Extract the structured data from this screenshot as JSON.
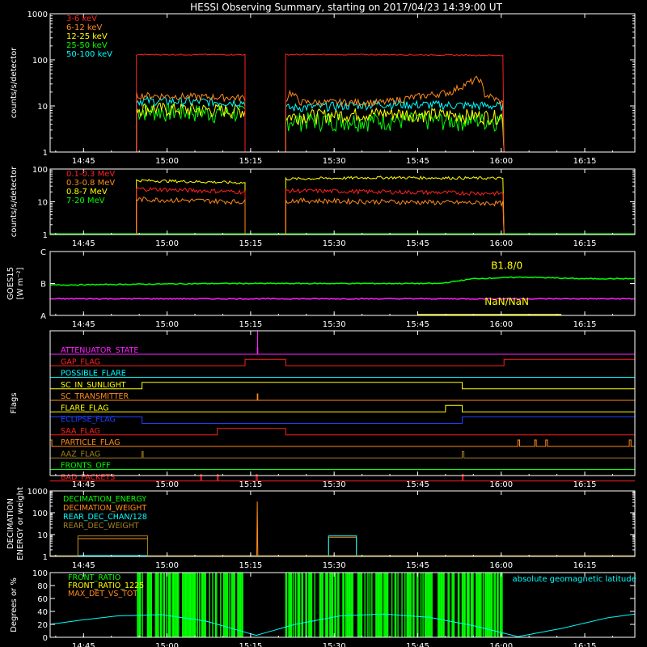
{
  "title": "HESSI Observing Summary, starting on 2017/04/23 14:39:00 UT",
  "x_ticks": [
    "14:45",
    "15:00",
    "15:15",
    "15:30",
    "15:45",
    "16:00",
    "16:15"
  ],
  "x_tick_minutes": [
    6,
    21,
    36,
    51,
    66,
    81,
    96
  ],
  "x_range_minutes": [
    0,
    105
  ],
  "colors": {
    "red": "#ff2020",
    "orange": "#ff8a1c",
    "yellow": "#ffff00",
    "green": "#00ff00",
    "cyan": "#00ffff",
    "magenta": "#ff20ff",
    "blue": "#2040ff",
    "olive": "#a08020",
    "white": "#ffffff"
  },
  "chart_data": [
    {
      "type": "line",
      "panel": "xray",
      "ylabel": "counts/s/detector",
      "yscale": "log",
      "ylim": [
        1,
        1000
      ],
      "y_ticks": [
        "1",
        "10",
        "100",
        "1000"
      ],
      "segments_minutes": [
        [
          15.5,
          35
        ],
        [
          42.3,
          81.5
        ]
      ],
      "series": [
        {
          "name": "3-6 keV",
          "color": "red",
          "values": [
            [
              15.5,
              130
            ],
            [
              35,
              130
            ],
            [
              42.3,
              130
            ],
            [
              60,
              130
            ],
            [
              81.5,
              125
            ]
          ]
        },
        {
          "name": "6-12 keV",
          "color": "orange",
          "values": [
            [
              15.5,
              17
            ],
            [
              35,
              15
            ],
            [
              42.3,
              12
            ],
            [
              43,
              20
            ],
            [
              45,
              12
            ],
            [
              60,
              12
            ],
            [
              72,
              20
            ],
            [
              76,
              35
            ],
            [
              77,
              40
            ],
            [
              78,
              18
            ],
            [
              81.5,
              11
            ]
          ]
        },
        {
          "name": "12-25 keV",
          "color": "yellow",
          "values": [
            [
              15.5,
              9
            ],
            [
              35,
              8
            ],
            [
              42.3,
              6
            ],
            [
              60,
              7
            ],
            [
              81.5,
              6
            ]
          ]
        },
        {
          "name": "25-50 keV",
          "color": "green",
          "values": [
            [
              15.5,
              8
            ],
            [
              35,
              7
            ],
            [
              42.3,
              5
            ],
            [
              60,
              5
            ],
            [
              81.5,
              5
            ]
          ]
        },
        {
          "name": "50-100 keV",
          "color": "cyan",
          "values": [
            [
              15.5,
              13
            ],
            [
              35,
              12
            ],
            [
              42.3,
              9
            ],
            [
              60,
              11
            ],
            [
              81.5,
              10
            ]
          ]
        }
      ]
    },
    {
      "type": "line",
      "panel": "gamma",
      "ylabel": "counts/s/detector",
      "yscale": "log",
      "ylim": [
        1,
        100
      ],
      "y_ticks": [
        "1",
        "10",
        "100"
      ],
      "segments_minutes": [
        [
          15.5,
          35
        ],
        [
          42.3,
          81.5
        ]
      ],
      "series": [
        {
          "name": "0.1-0.3 MeV",
          "color": "red",
          "values": [
            [
              15.5,
              25
            ],
            [
              35,
              20
            ],
            [
              42.3,
              22
            ],
            [
              81.5,
              18
            ]
          ]
        },
        {
          "name": "0.3-0.8 MeV",
          "color": "orange",
          "values": [
            [
              15.5,
              12
            ],
            [
              35,
              10
            ],
            [
              42.3,
              11
            ],
            [
              81.5,
              9
            ]
          ]
        },
        {
          "name": "0.8-7 MeV",
          "color": "yellow",
          "values": [
            [
              15.5,
              45
            ],
            [
              35,
              38
            ],
            [
              42.3,
              50
            ],
            [
              60,
              55
            ],
            [
              81.5,
              52
            ]
          ]
        },
        {
          "name": "7-20 MeV",
          "color": "green",
          "values": [
            [
              0,
              1
            ],
            [
              105,
              1
            ]
          ]
        }
      ]
    },
    {
      "type": "line",
      "panel": "goes",
      "ylabel": "GOES15",
      "ylabel2": "[W m⁻²]",
      "y_ticks": [
        "A",
        "B",
        "C"
      ],
      "ylim": [
        0,
        2
      ],
      "annotations": [
        "B1.8/0",
        "NaN/NaN"
      ],
      "series": [
        {
          "name": "",
          "color": "green",
          "values": [
            [
              0,
              0.95
            ],
            [
              30,
              1.0
            ],
            [
              70,
              1.0
            ],
            [
              76,
              1.15
            ],
            [
              85,
              1.2
            ],
            [
              95,
              1.15
            ],
            [
              105,
              1.15
            ]
          ]
        },
        {
          "name": "",
          "color": "magenta",
          "values": [
            [
              0,
              0.52
            ],
            [
              105,
              0.52
            ]
          ]
        },
        {
          "name": "",
          "color": "yellow",
          "values": [
            [
              66,
              0.0
            ],
            [
              92,
              0.0
            ]
          ]
        }
      ]
    },
    {
      "type": "line",
      "panel": "flags",
      "ylabel": "Flags",
      "flags": [
        {
          "label": "ATTENUATOR_STATE",
          "color": "magenta"
        },
        {
          "label": "GAP_FLAG",
          "color": "red"
        },
        {
          "label": "POSSIBLE_FLARE",
          "color": "cyan"
        },
        {
          "label": "SC_IN_SUNLIGHT",
          "color": "yellow"
        },
        {
          "label": "SC_TRANSMITTER",
          "color": "orange"
        },
        {
          "label": "FLARE_FLAG",
          "color": "yellow"
        },
        {
          "label": "ECLIPSE_FLAG",
          "color": "blue"
        },
        {
          "label": "SAA_FLAG",
          "color": "red"
        },
        {
          "label": "PARTICLE_FLAG",
          "color": "orange"
        },
        {
          "label": "AAZ_FLAG",
          "color": "olive"
        },
        {
          "label": "FRONTS_OFF",
          "color": "green"
        },
        {
          "label": "BAD_PACKETS",
          "color": "red"
        }
      ],
      "flag_high_minutes": [
        [
          [
            37.2,
            37.3
          ]
        ],
        [
          [
            35,
            42.3
          ],
          [
            81.5,
            105
          ]
        ],
        [],
        [
          [
            16.5,
            74
          ]
        ],
        [
          [
            37.2,
            37.3
          ]
        ],
        [
          [
            71,
            74
          ]
        ],
        [
          [
            0,
            16.5
          ],
          [
            74,
            105
          ]
        ],
        [
          [
            30,
            42.3
          ]
        ],
        [
          [
            0,
            0.3
          ],
          [
            84,
            84.3
          ],
          [
            87,
            87.3
          ],
          [
            89,
            89.3
          ],
          [
            104,
            104.3
          ]
        ],
        [
          [
            16.5,
            16.7
          ],
          [
            74,
            74.3
          ]
        ],
        [],
        [
          [
            27,
            27.2
          ],
          [
            30,
            30.2
          ],
          [
            37,
            37.2
          ],
          [
            74,
            74.2
          ]
        ]
      ]
    },
    {
      "type": "line",
      "panel": "decimation",
      "ylabel": "DECIMATION",
      "ylabel2": "ENERGY or weight",
      "yscale": "log",
      "ylim": [
        1,
        1000
      ],
      "y_ticks": [
        "1",
        "10",
        "100",
        "1000"
      ],
      "series": [
        {
          "name": "DECIMATION_ENERGY",
          "color": "green",
          "values": [
            [
              0,
              1
            ],
            [
              105,
              1
            ]
          ]
        },
        {
          "name": "DECIMATION_WEIGHT",
          "color": "orange",
          "values": [
            [
              0,
              1
            ],
            [
              5,
              1
            ],
            [
              5,
              6
            ],
            [
              17.5,
              6
            ],
            [
              17.5,
              1
            ],
            [
              37.1,
              1
            ],
            [
              37.2,
              300
            ],
            [
              37.3,
              1
            ],
            [
              50,
              1
            ],
            [
              50,
              7
            ],
            [
              55,
              7
            ],
            [
              55,
              1
            ],
            [
              105,
              1
            ]
          ]
        },
        {
          "name": "REAR_DEC_CHAN/128",
          "color": "cyan",
          "values": [
            [
              0,
              1
            ],
            [
              50,
              1
            ],
            [
              50,
              8
            ],
            [
              55,
              8
            ],
            [
              55,
              1
            ],
            [
              105,
              1
            ]
          ]
        },
        {
          "name": "REAR_DEC_WEIGHT",
          "color": "olive",
          "values": [
            [
              0,
              1
            ],
            [
              5,
              1
            ],
            [
              5,
              8
            ],
            [
              17.5,
              8
            ],
            [
              17.5,
              1
            ],
            [
              105,
              1
            ]
          ]
        }
      ]
    },
    {
      "type": "line",
      "panel": "ratio",
      "ylabel": "Degrees or %",
      "ylim": [
        0,
        100
      ],
      "y_ticks": [
        "0",
        "20",
        "40",
        "60",
        "80",
        "100"
      ],
      "annotations": [
        "absolute geomagnetic latitude"
      ],
      "segments_minutes": [
        [
          15.5,
          35
        ],
        [
          42.3,
          81.5
        ]
      ],
      "series": [
        {
          "name": "FRONT_RATIO",
          "color": "green",
          "values": []
        },
        {
          "name": "FRONT_RATIO_1225",
          "color": "yellow",
          "values": []
        },
        {
          "name": "MAX_DET_VS_TOT",
          "color": "orange",
          "values": []
        },
        {
          "name": "absolute geomagnetic latitude",
          "color": "cyan",
          "values": [
            [
              0,
              20
            ],
            [
              5,
              26
            ],
            [
              12,
              33
            ],
            [
              20,
              35
            ],
            [
              28,
              25
            ],
            [
              37,
              3
            ],
            [
              44,
              20
            ],
            [
              52,
              33
            ],
            [
              60,
              36
            ],
            [
              68,
              31
            ],
            [
              76,
              18
            ],
            [
              84,
              1
            ],
            [
              92,
              14
            ],
            [
              100,
              30
            ],
            [
              105,
              36
            ]
          ]
        }
      ]
    }
  ]
}
